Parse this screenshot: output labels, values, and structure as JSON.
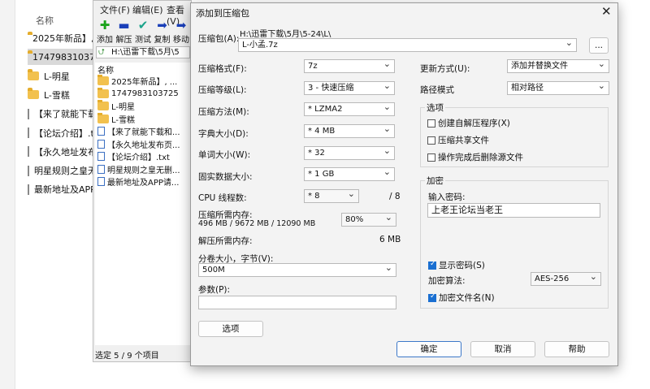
{
  "explorer": {
    "header": "名称",
    "items": [
      {
        "type": "folder",
        "name": "2025年新品】, ..."
      },
      {
        "type": "folder",
        "name": "17479831037..."
      },
      {
        "type": "folder",
        "name": "L-明星"
      },
      {
        "type": "folder",
        "name": "L-雪糕"
      },
      {
        "type": "file",
        "name": "【来了就能下载..."
      },
      {
        "type": "file",
        "name": "【论坛介绍】.t..."
      },
      {
        "type": "file",
        "name": "【永久地址发布..."
      },
      {
        "type": "file",
        "name": "明星规则之皇无..."
      },
      {
        "type": "file",
        "name": "最新地址及APP..."
      }
    ]
  },
  "zip": {
    "menu": [
      "文件(F)",
      "编辑(E)",
      "查看(V)"
    ],
    "toolbar": [
      {
        "label": "添加",
        "icon": "add-icon",
        "glyph": "✚",
        "color": "#1aa31a"
      },
      {
        "label": "解压",
        "icon": "extract-icon",
        "glyph": "▬",
        "color": "#1a3fb8"
      },
      {
        "label": "测试",
        "icon": "test-icon",
        "glyph": "✔",
        "color": "#1aa38a"
      },
      {
        "label": "复制",
        "icon": "copy-icon",
        "glyph": "➡",
        "color": "#1a3fb8"
      },
      {
        "label": "移动",
        "icon": "move-icon",
        "glyph": "➡",
        "color": "#1a3fb8"
      }
    ],
    "address": "H:\\迅雷下载\\5月\\5",
    "list_header": "名称",
    "items": [
      {
        "type": "folder",
        "name": "2025年新品】, ..."
      },
      {
        "type": "folder",
        "name": "17479831037​25"
      },
      {
        "type": "folder",
        "name": "L-明星"
      },
      {
        "type": "folder",
        "name": "L-雪糕"
      },
      {
        "type": "file",
        "name": "【来了就能下载和..."
      },
      {
        "type": "file",
        "name": "【永久地址发布页..."
      },
      {
        "type": "file",
        "name": "【论坛介绍】.txt"
      },
      {
        "type": "file",
        "name": "明星规则之皇无删..."
      },
      {
        "type": "file",
        "name": "最新地址及APP请..."
      }
    ],
    "status": "选定 5 / 9 个项目"
  },
  "dialog": {
    "title": "添加到压缩包",
    "archive_label": "压缩包(A):",
    "archive_path": "H:\\迅雷下载\\5月\\5-24\\L\\",
    "archive_name": "L-小孟.7z",
    "browse_label": "...",
    "fields": {
      "format": {
        "label": "压缩格式(F):",
        "value": "7z"
      },
      "level": {
        "label": "压缩等级(L):",
        "value": "3 - 快速压缩"
      },
      "method": {
        "label": "压缩方法(M):",
        "value": "* LZMA2"
      },
      "dict": {
        "label": "字典大小(D):",
        "value": "* 4 MB"
      },
      "word": {
        "label": "单词大小(W):",
        "value": "* 32"
      },
      "solid": {
        "label": "固实数据大小:",
        "value": "* 1 GB"
      },
      "threads": {
        "label": "CPU 线程数:",
        "value": "* 8",
        "max": "/ 8"
      }
    },
    "mem_compress_label": "压缩所需内存:",
    "mem_compress_detail": "496 MB / 9672 MB / 12090 MB",
    "mem_compress_value": "80%",
    "mem_decompress_label": "解压所需内存:",
    "mem_decompress_value": "6 MB",
    "volume_label": "分卷大小，字节(V):",
    "volume_value": "500M",
    "params_label": "参数(P):",
    "params_value": "",
    "options_button": "选项",
    "update_label": "更新方式(U):",
    "update_value": "添加并替换文件",
    "path_label": "路径模式",
    "path_value": "相对路径",
    "options_group": "选项",
    "opt_sfx": "创建自解压程序(X)",
    "opt_shared": "压缩共享文件",
    "opt_delete": "操作完成后删除源文件",
    "encrypt_group": "加密",
    "password_label": "输入密码:",
    "password_value": "上老王论坛当老王",
    "show_password": "显示密码(S)",
    "enc_method_label": "加密算法:",
    "enc_method_value": "AES-256",
    "enc_names": "加密文件名(N)",
    "ok": "确定",
    "cancel": "取消",
    "help": "帮助"
  }
}
